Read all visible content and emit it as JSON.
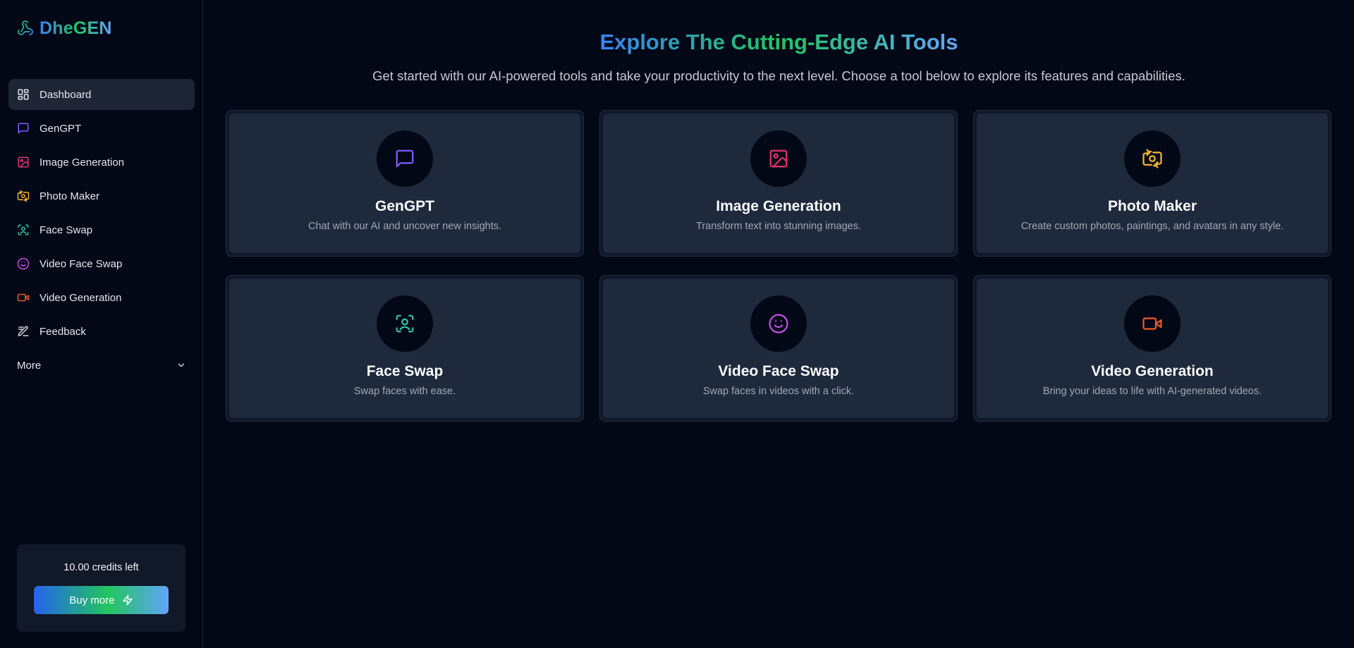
{
  "app": {
    "name": "DheGEN"
  },
  "sidebar": {
    "items": [
      {
        "label": "Dashboard",
        "icon": "dashboard-icon",
        "active": true
      },
      {
        "label": "GenGPT",
        "icon": "chat-icon"
      },
      {
        "label": "Image Generation",
        "icon": "image-icon"
      },
      {
        "label": "Photo Maker",
        "icon": "camera-swap-icon"
      },
      {
        "label": "Face Swap",
        "icon": "face-scan-icon"
      },
      {
        "label": "Video Face Swap",
        "icon": "smile-icon"
      },
      {
        "label": "Video Generation",
        "icon": "video-icon"
      },
      {
        "label": "Feedback",
        "icon": "feedback-icon"
      }
    ],
    "more_label": "More",
    "credits_text": "10.00 credits left",
    "buy_label": "Buy more"
  },
  "main": {
    "headline": "Explore The Cutting-Edge AI Tools",
    "subhead": "Get started with our AI-powered tools and take your productivity to the next level. Choose a tool below to explore its features and capabilities.",
    "tools": [
      {
        "title": "GenGPT",
        "desc": "Chat with our AI and uncover new insights.",
        "icon": "chat-icon",
        "color": "#7c5cff"
      },
      {
        "title": "Image Generation",
        "desc": "Transform text into stunning images.",
        "icon": "image-icon",
        "color": "#e0336f"
      },
      {
        "title": "Photo Maker",
        "desc": "Create custom photos, paintings, and avatars in any style.",
        "icon": "camera-swap-icon",
        "color": "#f2b431"
      },
      {
        "title": "Face Swap",
        "desc": "Swap faces with ease.",
        "icon": "face-scan-icon",
        "color": "#2fc4a4"
      },
      {
        "title": "Video Face Swap",
        "desc": "Swap faces in videos with a click.",
        "icon": "smile-icon",
        "color": "#c34ee8"
      },
      {
        "title": "Video Generation",
        "desc": "Bring your ideas to life with AI-generated videos.",
        "icon": "video-icon",
        "color": "#ef5a27"
      }
    ]
  },
  "colors": {
    "background": "#030817",
    "card": "#1e293b",
    "nav_active": "#1e2636",
    "dashboard_icon": "#e5e7eb",
    "gengpt": "#7c5cff",
    "image": "#e0336f",
    "photo": "#f2b431",
    "face": "#2fc4a4",
    "video_face": "#c34ee8",
    "video": "#ef5a27",
    "feedback": "#d1d5db"
  }
}
